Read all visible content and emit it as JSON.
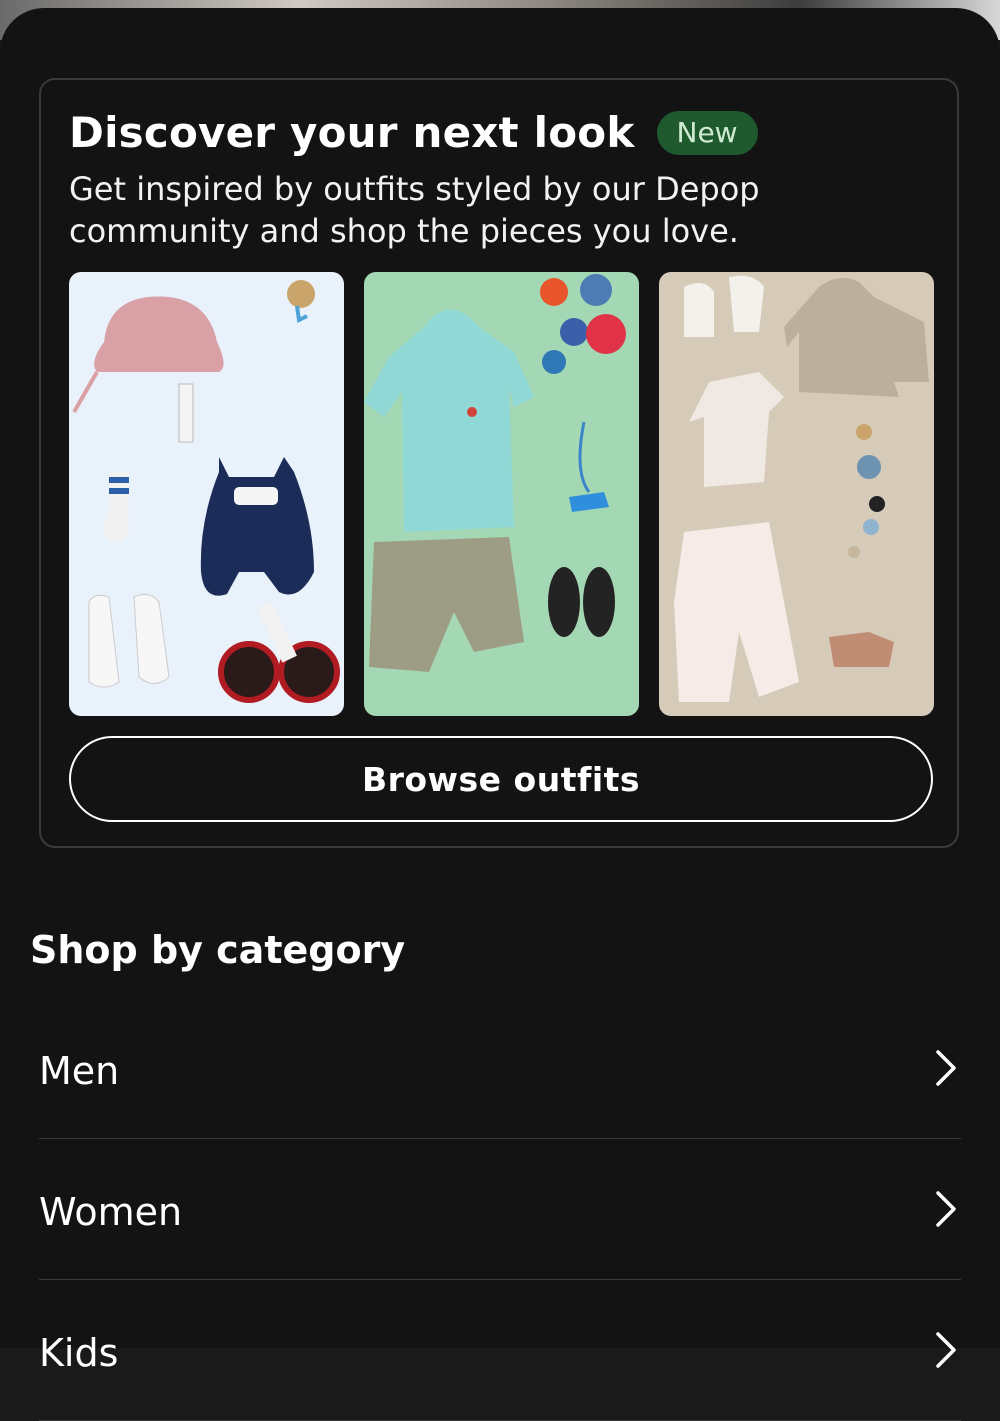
{
  "card": {
    "title": "Discover your next look",
    "badge": "New",
    "description": "Get inspired by outfits styled by our Depop community and shop the pieces you love.",
    "browse_label": "Browse outfits"
  },
  "shop": {
    "title": "Shop by category",
    "categories": [
      {
        "label": "Men"
      },
      {
        "label": "Women"
      },
      {
        "label": "Kids"
      }
    ]
  },
  "colors": {
    "background": "#131313",
    "badge_bg": "#1f5a2e",
    "tile_1": "#e9f1fb",
    "tile_2": "#a4d8b4",
    "tile_3": "#d6cbb8"
  }
}
